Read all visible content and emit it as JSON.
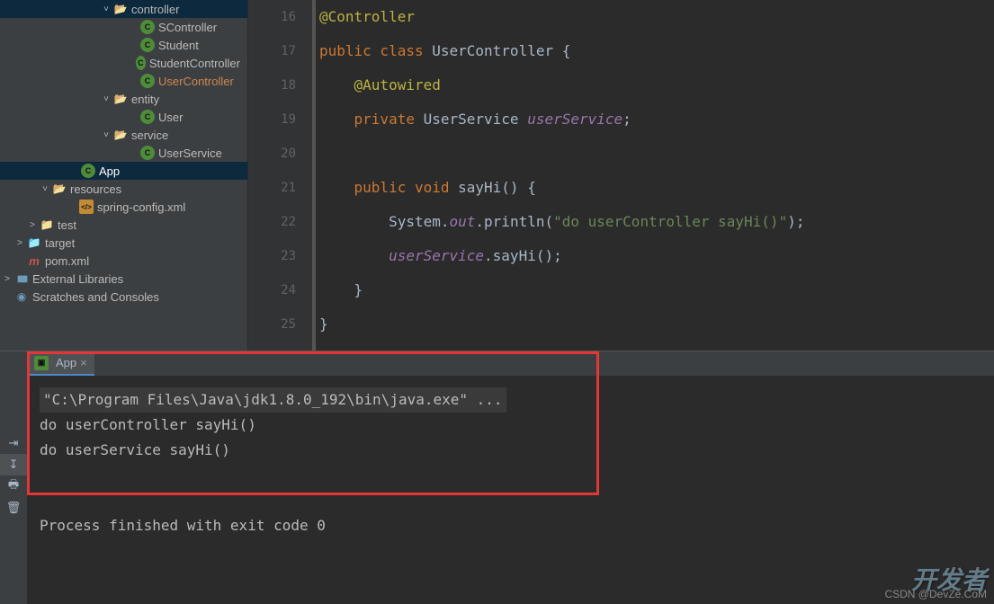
{
  "sidebar": {
    "items": [
      {
        "indent": 110,
        "arrow": "˅",
        "icon": "folder-open",
        "label": "controller"
      },
      {
        "indent": 140,
        "arrow": "",
        "icon": "class",
        "label": "SController"
      },
      {
        "indent": 140,
        "arrow": "",
        "icon": "class",
        "label": "Student"
      },
      {
        "indent": 140,
        "arrow": "",
        "icon": "class",
        "label": "StudentController"
      },
      {
        "indent": 140,
        "arrow": "",
        "icon": "class",
        "label": "UserController",
        "highlighted": true
      },
      {
        "indent": 110,
        "arrow": "˅",
        "icon": "folder-open",
        "label": "entity"
      },
      {
        "indent": 140,
        "arrow": "",
        "icon": "class",
        "label": "User"
      },
      {
        "indent": 110,
        "arrow": "˅",
        "icon": "folder-open",
        "label": "service"
      },
      {
        "indent": 140,
        "arrow": "",
        "icon": "class",
        "label": "UserService"
      },
      {
        "indent": 74,
        "arrow": "",
        "icon": "class",
        "label": "App",
        "selected": true
      },
      {
        "indent": 42,
        "arrow": "˅",
        "icon": "folder-open",
        "label": "resources"
      },
      {
        "indent": 72,
        "arrow": "",
        "icon": "xml",
        "label": "spring-config.xml"
      },
      {
        "indent": 28,
        "arrow": ">",
        "icon": "folder",
        "label": "test"
      },
      {
        "indent": 14,
        "arrow": ">",
        "icon": "target",
        "label": "target"
      },
      {
        "indent": 14,
        "arrow": "",
        "icon": "maven",
        "label": "pom.xml"
      },
      {
        "indent": 0,
        "arrow": ">",
        "icon": "lib",
        "label": "External Libraries"
      },
      {
        "indent": 0,
        "arrow": "",
        "icon": "scratch",
        "label": "Scratches and Consoles"
      }
    ]
  },
  "editor": {
    "line_start": 16,
    "lines": [
      [
        {
          "c": "k-ann",
          "t": "@Controller"
        }
      ],
      [
        {
          "c": "k-key",
          "t": "public class "
        },
        {
          "c": "k-type",
          "t": "UserController {"
        }
      ],
      [
        {
          "c": "",
          "t": "    "
        },
        {
          "c": "k-ann",
          "t": "@Autowired"
        }
      ],
      [
        {
          "c": "",
          "t": "    "
        },
        {
          "c": "k-key",
          "t": "private "
        },
        {
          "c": "k-type",
          "t": "UserService "
        },
        {
          "c": "k-field",
          "t": "userService"
        },
        {
          "c": "k-op",
          "t": ";"
        }
      ],
      [
        {
          "c": "",
          "t": ""
        }
      ],
      [
        {
          "c": "",
          "t": "    "
        },
        {
          "c": "k-key",
          "t": "public void "
        },
        {
          "c": "k-type",
          "t": "sayHi() {"
        }
      ],
      [
        {
          "c": "",
          "t": "        System."
        },
        {
          "c": "k-field",
          "t": "out"
        },
        {
          "c": "k-type",
          "t": ".println("
        },
        {
          "c": "k-str",
          "t": "\"do userController sayHi()\""
        },
        {
          "c": "k-type",
          "t": ");"
        }
      ],
      [
        {
          "c": "",
          "t": "        "
        },
        {
          "c": "k-field",
          "t": "userService"
        },
        {
          "c": "k-type",
          "t": ".sayHi();"
        }
      ],
      [
        {
          "c": "",
          "t": "    }"
        }
      ],
      [
        {
          "c": "",
          "t": "}"
        }
      ]
    ]
  },
  "run": {
    "tab_label": "App",
    "console": [
      {
        "cls": "cmd",
        "t": "\"C:\\Program Files\\Java\\jdk1.8.0_192\\bin\\java.exe\" ..."
      },
      {
        "cls": "",
        "t": "do userController sayHi()"
      },
      {
        "cls": "",
        "t": "do userService sayHi()"
      },
      {
        "cls": "",
        "t": ""
      },
      {
        "cls": "",
        "t": ""
      },
      {
        "cls": "",
        "t": "Process finished with exit code 0"
      }
    ]
  },
  "watermark": {
    "main": "开发者",
    "sub": "CSDN @DevZe.CoM"
  }
}
